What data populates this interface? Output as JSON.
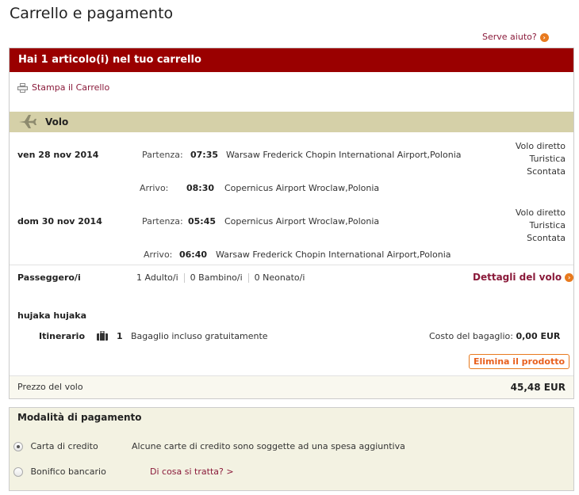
{
  "page_title": "Carrello e pagamento",
  "help_link": "Serve aiuto?",
  "cart": {
    "header": "Hai 1 articolo(i) nel tuo carrello",
    "print_link": "Stampa il Carrello",
    "section_label": "Volo",
    "flights": [
      {
        "date": "ven 28 nov 2014",
        "departure_label": "Partenza:",
        "departure_time": "07:35",
        "departure_airport": "Warsaw Frederick Chopin International Airport,Polonia",
        "arrival_label": "Arrivo:",
        "arrival_time": "08:30",
        "arrival_airport": "Copernicus Airport Wroclaw,Polonia",
        "flight_type": "Volo diretto",
        "cabin": "Turistica",
        "fare": "Scontata"
      },
      {
        "date": "dom 30 nov 2014",
        "departure_label": "Partenza:",
        "departure_time": "05:45",
        "departure_airport": "Copernicus Airport Wroclaw,Polonia",
        "arrival_label": "Arrivo:",
        "arrival_time": "06:40",
        "arrival_airport": "Warsaw Frederick Chopin International Airport,Polonia",
        "flight_type": "Volo diretto",
        "cabin": "Turistica",
        "fare": "Scontata"
      }
    ],
    "passengers_label": "Passeggero/i",
    "adults": "1 Adulto/i",
    "children": "0 Bambino/i",
    "infants": "0 Neonato/i",
    "details_link": "Dettagli del volo",
    "passenger_name": "hujaka hujaka",
    "itinerary_label": "Itinerario",
    "baggage_count": "1",
    "baggage_text": "Bagaglio incluso gratuitamente",
    "baggage_cost_label": "Costo del bagaglio:",
    "baggage_cost_value": "0,00 EUR",
    "remove_button": "Elimina il prodotto",
    "price_label": "Prezzo del volo",
    "price_value": "45,48 EUR"
  },
  "payment": {
    "title": "Modalità di pagamento",
    "options": [
      {
        "label": "Carta di credito",
        "note": "Alcune carte di credito sono soggette ad una spesa aggiuntiva",
        "selected": true
      },
      {
        "label": "Bonifico bancario",
        "note": "Di cosa si tratta? >",
        "selected": false
      }
    ]
  },
  "colors": {
    "header_red": "#9a0000",
    "section_tan": "#d5d0a8",
    "link_burgundy": "#8a1a3a",
    "accent_orange": "#e87a1e"
  },
  "icons": [
    "printer-icon",
    "plane-icon",
    "suitcase-icon",
    "arrow-circle-icon",
    "radio-icon"
  ]
}
